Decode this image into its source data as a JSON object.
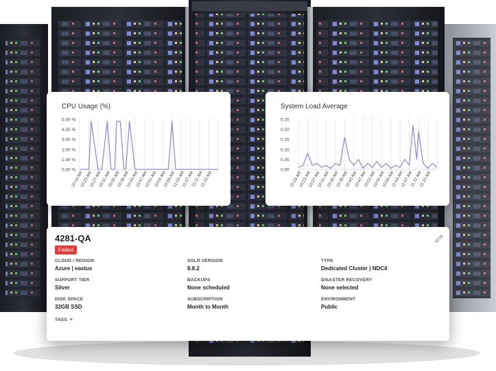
{
  "cpu_chart": {
    "title": "CPU Usage (%)",
    "chart_data": {
      "type": "line",
      "title": "CPU Usage (%)",
      "x": [
        "10:19 AM",
        "10:23 AM",
        "10:27 AM",
        "10:31 AM",
        "10:35 AM",
        "10:39 AM",
        "10:43 AM",
        "10:47 AM",
        "10:51 AM",
        "10:55 AM",
        "10:59 AM",
        "11:03 AM",
        "11:07 AM",
        "11:11 AM",
        "11:15 AM"
      ],
      "y_ticks": [
        "5.00 %",
        "4.00 %",
        "3.00 %",
        "2.00 %",
        "1.00 %",
        "0.00 %"
      ],
      "ylim": [
        0,
        5
      ],
      "series": [
        {
          "values_x": [
            0,
            1,
            1.25,
            2,
            2.4,
            3,
            3.4,
            3.8,
            4,
            4.4,
            4.8,
            5,
            5.4,
            6,
            8,
            9.6,
            10,
            10.4,
            15
          ],
          "values_y": [
            0,
            0,
            4.8,
            0,
            0,
            4.8,
            0,
            0,
            4.8,
            4.8,
            0,
            0,
            4.8,
            0,
            0,
            0,
            4.8,
            0,
            0
          ]
        }
      ],
      "color": "#9c88d8",
      "grid": "vertical"
    }
  },
  "load_chart": {
    "title": "System Load Average",
    "chart_data": {
      "type": "line",
      "title": "System Load Average",
      "x": [
        "10:19 AM",
        "10:23 AM",
        "10:27 AM",
        "10:31 AM",
        "10:35 AM",
        "10:39 AM",
        "10:43 AM",
        "10:47 AM",
        "10:51 AM",
        "10:55 AM",
        "10:59 AM",
        "11:03 AM",
        "11:07 AM",
        "11:11 AM",
        "11:15 AM"
      ],
      "y_ticks": [
        "0.25",
        "0.20",
        "0.15",
        "0.10",
        "0.05",
        "0.00"
      ],
      "ylim": [
        0,
        0.25
      ],
      "series": [
        {
          "values_x": [
            0,
            0.5,
            1,
            1.5,
            2,
            2.5,
            3,
            3.5,
            4,
            4.5,
            5,
            5.5,
            6,
            6.5,
            7,
            7.5,
            8,
            8.5,
            9,
            9.5,
            10,
            10.5,
            11,
            11.5,
            12,
            12.4,
            12.8,
            13,
            13.5,
            14,
            14.5,
            15
          ],
          "values_y": [
            0.01,
            0.02,
            0.08,
            0.02,
            0.03,
            0.01,
            0.02,
            0.005,
            0.03,
            0.02,
            0.16,
            0.05,
            0.02,
            0.05,
            0.005,
            0.03,
            0.01,
            0.04,
            0.01,
            0.03,
            0.005,
            0.02,
            0.01,
            0.05,
            0.02,
            0.22,
            0.05,
            0.19,
            0.03,
            0.005,
            0.03,
            0.01
          ]
        }
      ],
      "color": "#9c88d8",
      "grid": "vertical"
    }
  },
  "detail": {
    "title": "4281-QA",
    "status": "Failed",
    "fields": [
      {
        "label": "CLOUD / REGION",
        "value": "Azure | eastus"
      },
      {
        "label": "SOLR VERSION",
        "value": "8.8.2"
      },
      {
        "label": "TYPE",
        "value": "Dedicated Cluster | NDC4"
      },
      {
        "label": "SUPPORT  TIER",
        "value": "Silver"
      },
      {
        "label": "BACKUPS",
        "value": "None scheduled"
      },
      {
        "label": "DISASTER RECOVERY",
        "value": "None selected"
      },
      {
        "label": "DISK SPACE",
        "value": "32GB SSD"
      },
      {
        "label": "SUBSCRIPTION",
        "value": "Month to Month"
      },
      {
        "label": "ENVIRONMENT",
        "value": "Public"
      }
    ],
    "tags_label": "TAGS",
    "tags_add": "+"
  },
  "colors": {
    "accent": "#9c88d8",
    "failed": "#e53935",
    "link": "#1e6fd9"
  },
  "icons": {
    "edit": "pencil-icon"
  }
}
